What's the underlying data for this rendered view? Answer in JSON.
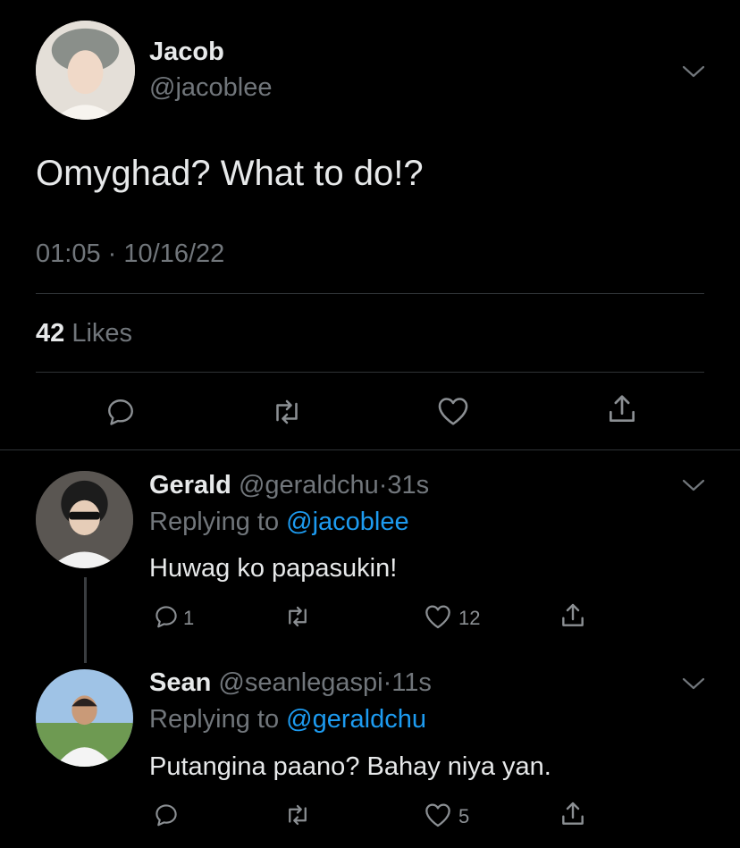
{
  "tweet": {
    "author_name": "Jacob",
    "author_handle": "@jacoblee",
    "text": "Omyghad? What to do!?",
    "time": "01:05",
    "separator": "·",
    "date": "10/16/22",
    "likes_count": "42",
    "likes_label": "Likes"
  },
  "replies": [
    {
      "name": "Gerald",
      "handle": "@geraldchu",
      "separator": "·",
      "age": "31s",
      "replying_prefix": "Replying to",
      "replying_handle": "@jacoblee",
      "text": "Huwag ko papasukin!",
      "reply_count": "1",
      "like_count": "12"
    },
    {
      "name": "Sean",
      "handle": "@seanlegaspi",
      "separator": "·",
      "age": "11s",
      "replying_prefix": "Replying to",
      "replying_handle": "@geraldchu",
      "text": "Putangina paano? Bahay niya yan.",
      "reply_count": "",
      "like_count": "5"
    }
  ],
  "colors": {
    "background": "#000000",
    "text": "#e7e9ea",
    "muted": "#71767b",
    "link": "#1d9bf0",
    "divider": "#2f3336"
  },
  "icons": [
    "chevron-down-icon",
    "reply-icon",
    "retweet-icon",
    "heart-icon",
    "share-icon"
  ]
}
